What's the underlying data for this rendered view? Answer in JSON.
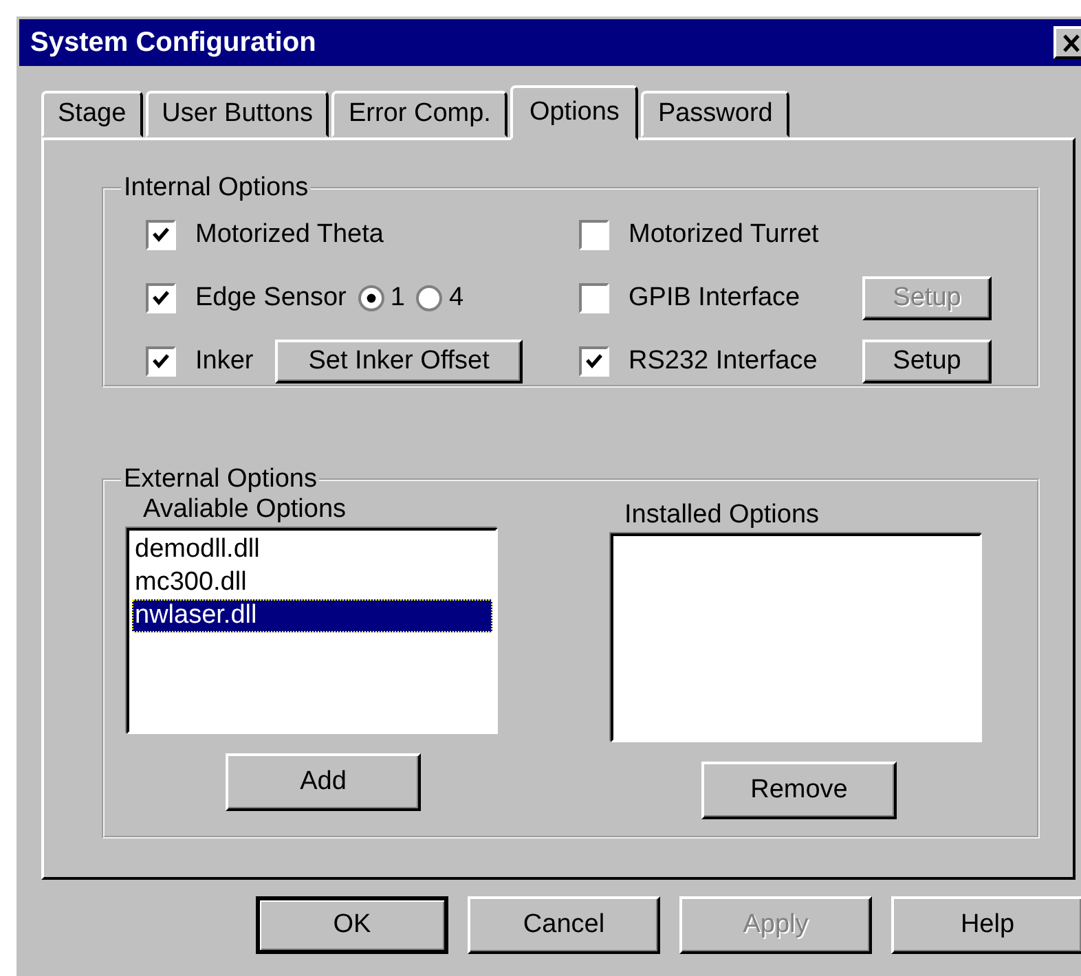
{
  "window": {
    "title": "System Configuration"
  },
  "tabs": [
    {
      "label": "Stage",
      "selected": false
    },
    {
      "label": "User Buttons",
      "selected": false
    },
    {
      "label": "Error Comp.",
      "selected": false
    },
    {
      "label": "Options",
      "selected": true
    },
    {
      "label": "Password",
      "selected": false
    }
  ],
  "internal_options": {
    "title": "Internal Options",
    "rows": [
      {
        "left": {
          "label": "Motorized Theta",
          "checked": true,
          "kind": "plain"
        },
        "right": {
          "label": "Motorized Turret",
          "checked": false
        }
      },
      {
        "left": {
          "label": "Edge Sensor",
          "checked": true,
          "kind": "radios",
          "radios": [
            {
              "label": "1",
              "selected": true
            },
            {
              "label": "4",
              "selected": false
            }
          ]
        },
        "right": {
          "label": "GPIB Interface",
          "checked": false,
          "setup": {
            "label": "Setup",
            "disabled": true
          }
        }
      },
      {
        "left": {
          "label": "Inker",
          "checked": true,
          "kind": "button",
          "button": {
            "label": "Set Inker Offset"
          }
        },
        "right": {
          "label": "RS232 Interface",
          "checked": true,
          "setup": {
            "label": "Setup",
            "disabled": false
          }
        }
      }
    ]
  },
  "external_options": {
    "title": "External Options",
    "available": {
      "label": "Avaliable Options",
      "items": [
        {
          "label": "demodll.dll",
          "selected": false
        },
        {
          "label": "mc300.dll",
          "selected": false
        },
        {
          "label": "nwlaser.dll",
          "selected": true
        }
      ],
      "button": "Add"
    },
    "installed": {
      "label": "Installed Options",
      "button": "Remove"
    }
  },
  "buttons": [
    {
      "label": "OK",
      "default": true,
      "disabled": false
    },
    {
      "label": "Cancel",
      "default": false,
      "disabled": false
    },
    {
      "label": "Apply",
      "default": false,
      "disabled": true
    },
    {
      "label": "Help",
      "default": false,
      "disabled": false
    }
  ]
}
